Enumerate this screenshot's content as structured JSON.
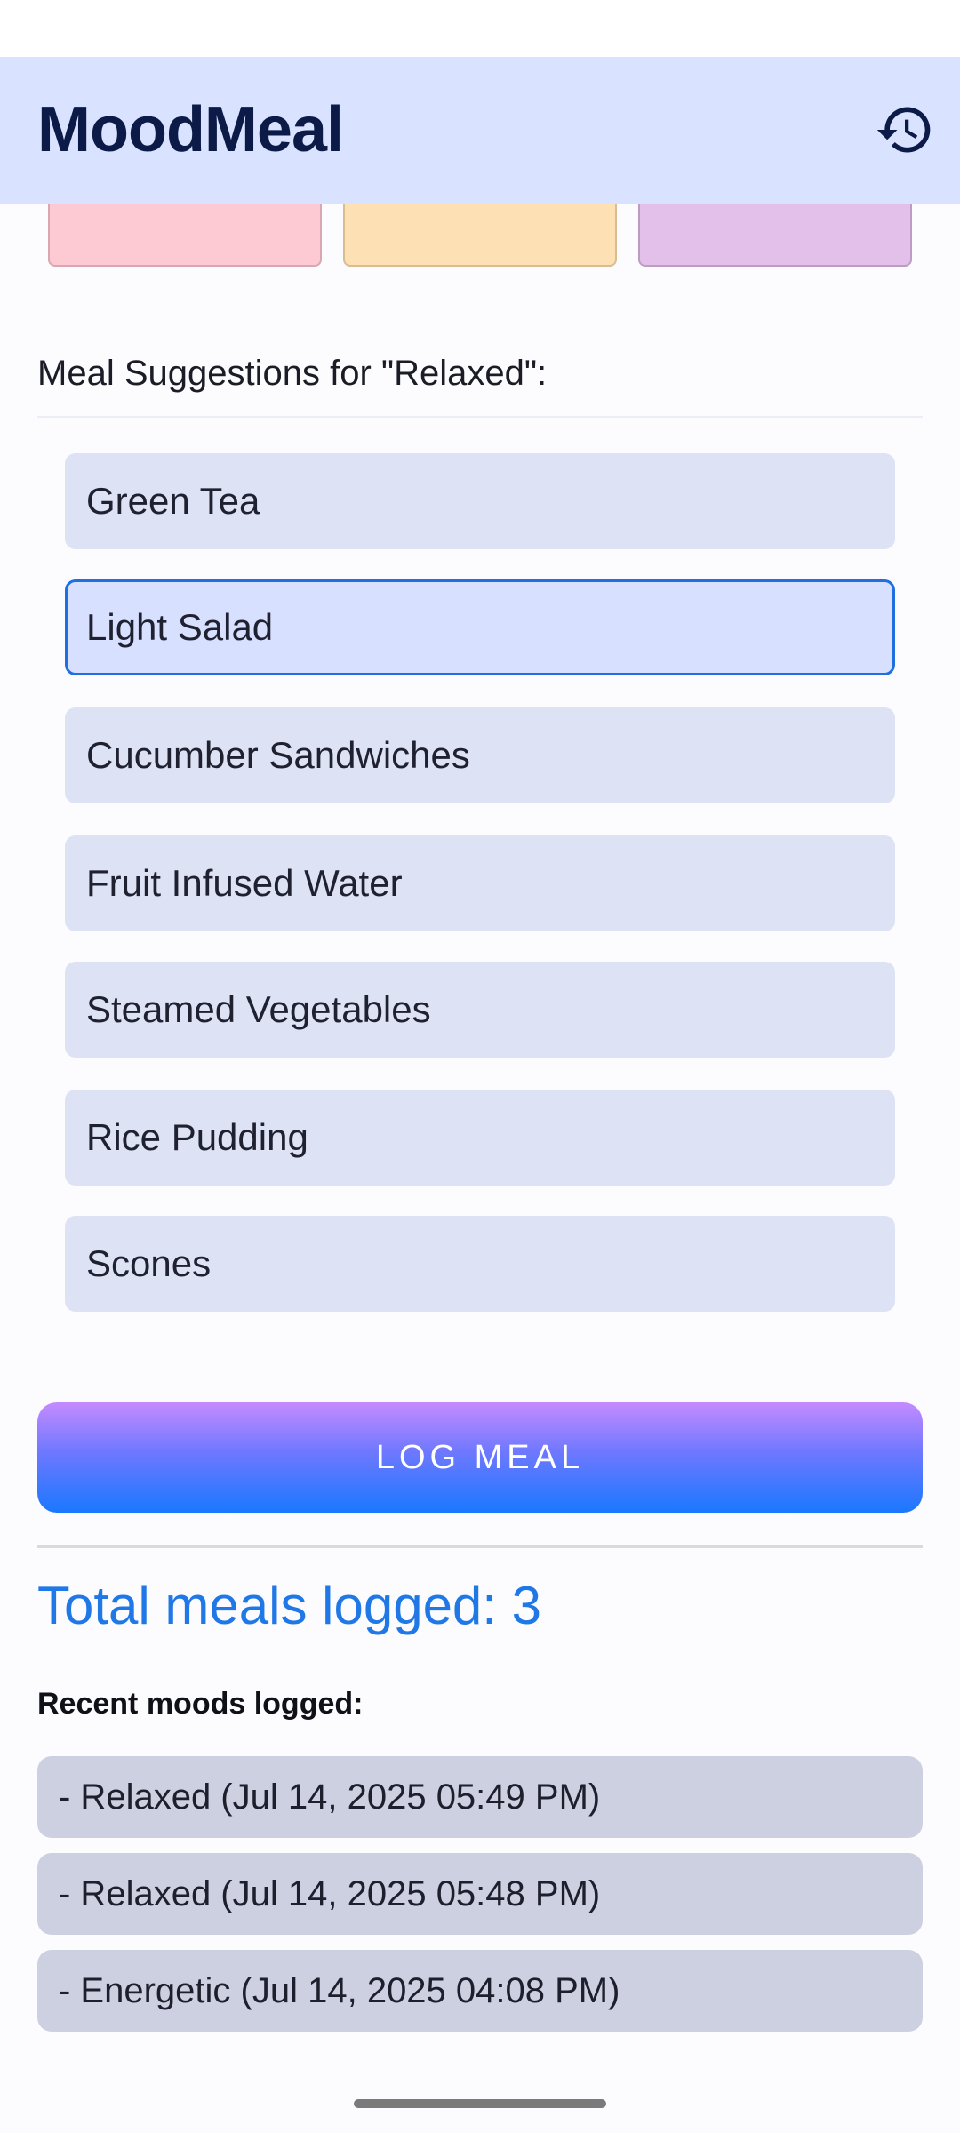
{
  "app": {
    "title": "MoodMeal",
    "history_icon": "history-icon",
    "header_bg": "#d9e2ff",
    "title_color": "#0b1a46"
  },
  "moods": {
    "chips": [
      {
        "color": "#fdcad3"
      },
      {
        "color": "#fde0b4"
      },
      {
        "color": "#e2c0ea"
      }
    ]
  },
  "suggestions": {
    "title": "Meal Suggestions for \"Relaxed\":",
    "selected_index": 1,
    "items": [
      "Green Tea",
      "Light Salad",
      "Cucumber Sandwiches",
      "Fruit Infused Water",
      "Steamed Vegetables",
      "Rice Pudding",
      "Scones"
    ],
    "item_bg": "#dde2f4",
    "selected_border": "#1f6fe0"
  },
  "actions": {
    "log_meal_label": "LOG MEAL"
  },
  "stats": {
    "total_meals_text": "Total meals logged: 3",
    "accent_color": "#1f78e6"
  },
  "recent": {
    "label": "Recent moods logged:",
    "items": [
      "- Relaxed (Jul 14, 2025 05:49 PM)",
      "- Relaxed (Jul 14, 2025 05:48 PM)",
      "- Energetic (Jul 14, 2025 04:08 PM)"
    ]
  }
}
